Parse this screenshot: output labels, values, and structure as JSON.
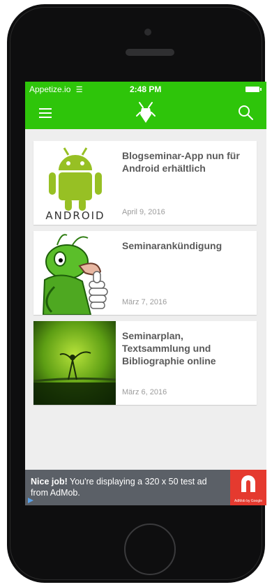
{
  "statusbar": {
    "carrier": "Appetize.io",
    "time": "2:48 PM"
  },
  "posts": [
    {
      "title": "Blogseminar-App nun für Android erhältlich",
      "date": "April 9, 2016",
      "thumb_text": "ANDROID"
    },
    {
      "title": "Seminarankündigung",
      "date": "März 7, 2016"
    },
    {
      "title": "Seminarplan, Textsammlung und Bibliographie online",
      "date": "März 6, 2016"
    }
  ],
  "ad": {
    "bold": "Nice job!",
    "text": " You're displaying a 320 x 50 test ad from AdMob.",
    "logo_caption": "AdMob by Google"
  },
  "colors": {
    "brand_green": "#2ec50a",
    "ad_red": "#e53a2f"
  },
  "icons": {
    "menu": "menu-icon",
    "logo": "cricket-logo-icon",
    "search": "search-icon"
  }
}
